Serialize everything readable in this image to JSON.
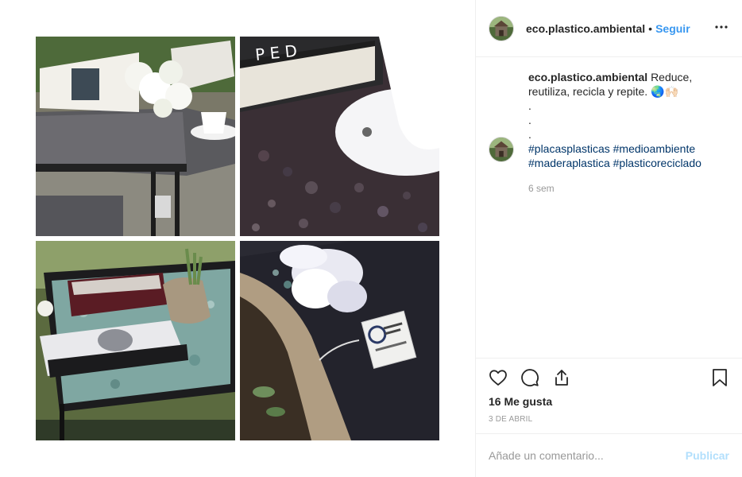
{
  "post": {
    "username": "eco.plastico.ambiental",
    "separator": "•",
    "follow_label": "Seguir",
    "more_icon": "more-horizontal-icon"
  },
  "images": [
    {
      "name": "table-with-flowers-and-book"
    },
    {
      "name": "recycled-plastic-surface-closeup-with-cup"
    },
    {
      "name": "table-with-books-and-plant"
    },
    {
      "name": "recycled-plastic-label-with-flower"
    }
  ],
  "caption": {
    "username": "eco.plastico.ambiental",
    "text": "Reduce, reutiliza, recicla y repite. 🌏🙌🏻",
    "dots": [
      ".",
      ".",
      "."
    ],
    "hashtags": [
      "#placasplasticas",
      "#medioambiente",
      "#maderaplastica",
      "#plasticoreciclado"
    ],
    "time_ago": "6 sem"
  },
  "actions": {
    "like_icon": "heart-icon",
    "comment_icon": "comment-icon",
    "share_icon": "share-icon",
    "save_icon": "bookmark-icon",
    "likes_text": "16 Me gusta",
    "date": "3 DE ABRIL"
  },
  "comment": {
    "placeholder": "Añade un comentario...",
    "publish_label": "Publicar"
  },
  "colors": {
    "link": "#3897f0",
    "hashtag": "#003569",
    "publish_disabled": "#b2dffc",
    "muted": "#999999"
  }
}
